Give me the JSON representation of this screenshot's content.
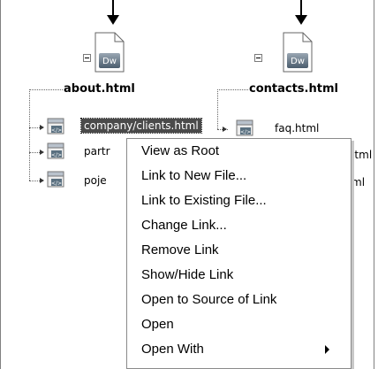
{
  "site_map": {
    "roots": [
      {
        "name": "about.html",
        "icon": "dreamweaver-doc-icon",
        "icon_text": "Dw"
      },
      {
        "name": "contacts.html",
        "icon": "dreamweaver-doc-icon",
        "icon_text": "Dw"
      }
    ],
    "children_left": [
      {
        "label": "company/clients.html",
        "selected": true
      },
      {
        "label": "partr"
      },
      {
        "label": "poje"
      }
    ],
    "children_right": [
      {
        "label": "faq.html"
      },
      {
        "label": ".html"
      },
      {
        "label": "ml"
      }
    ]
  },
  "context_menu": {
    "items": [
      {
        "label": "View as Root"
      },
      {
        "label": "Link to New File..."
      },
      {
        "label": "Link to Existing File..."
      },
      {
        "label": "Change Link..."
      },
      {
        "label": "Remove Link"
      },
      {
        "label": "Show/Hide Link"
      },
      {
        "label": "Open to Source of Link"
      },
      {
        "label": "Open"
      },
      {
        "label": "Open With",
        "has_submenu": true
      }
    ]
  },
  "colors": {
    "selection_bg": "#4a4a4a",
    "menu_bg": "#ffffff",
    "menu_border": "#8a8a8a",
    "dw_icon_gradient_top": "#9aa7b3",
    "dw_icon_gradient_bottom": "#4b5d6e"
  }
}
